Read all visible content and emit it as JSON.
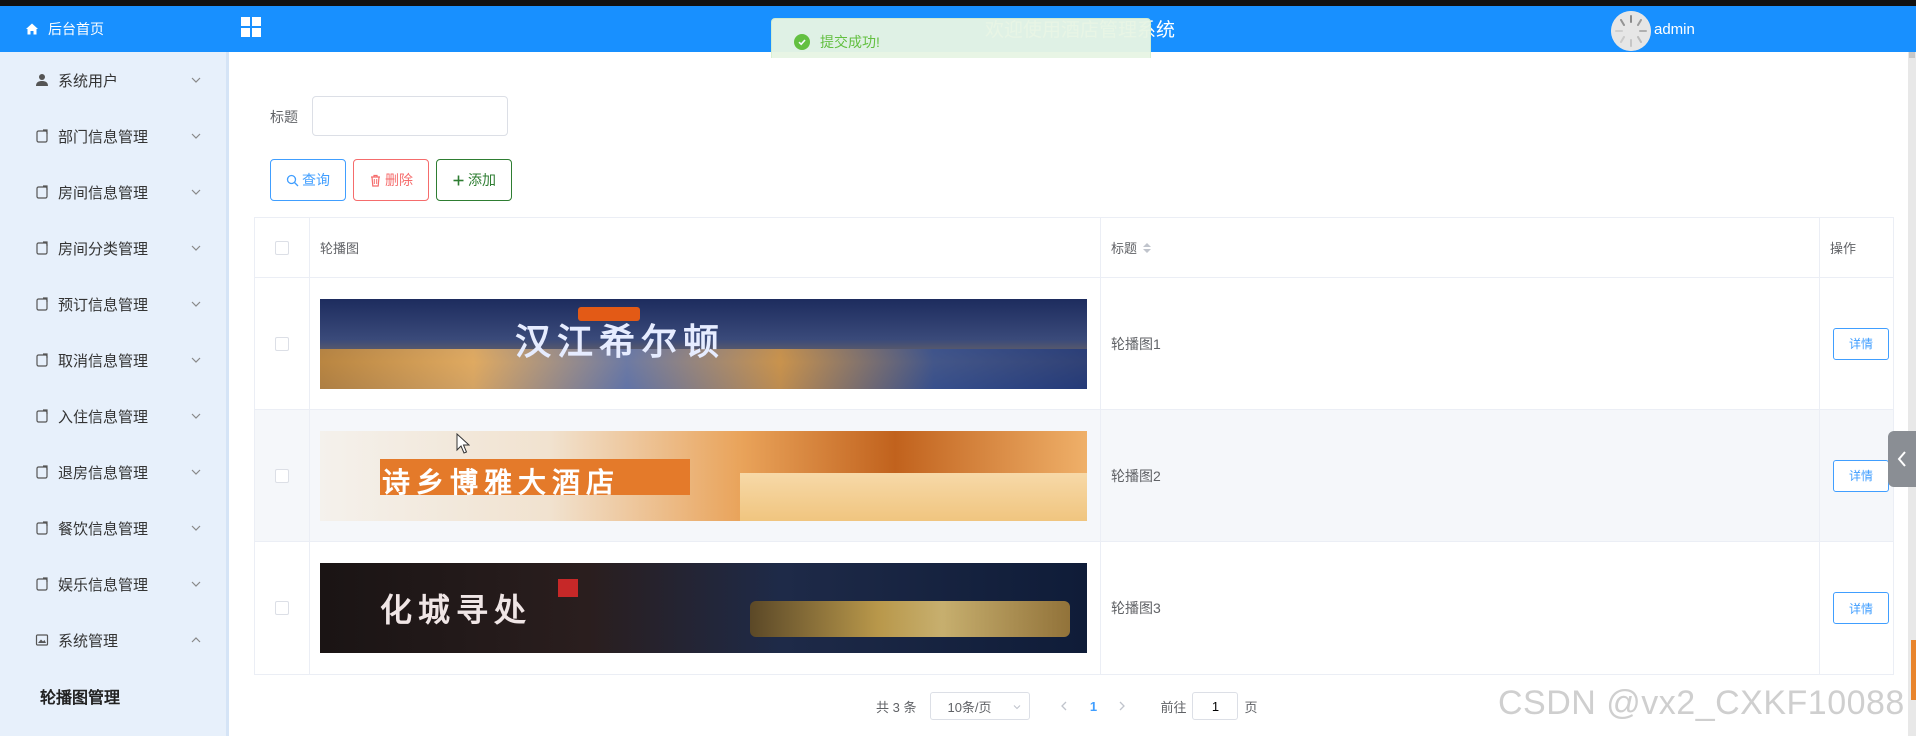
{
  "topbar": {
    "title": "欢迎使用酒店管理系统",
    "username": "admin"
  },
  "toast": {
    "message": "提交成功!"
  },
  "sidebar": {
    "home_label": "后台首页",
    "items": [
      {
        "label": "系统用户",
        "icon": "user-icon"
      },
      {
        "label": "部门信息管理",
        "icon": "document-icon"
      },
      {
        "label": "房间信息管理",
        "icon": "document-icon"
      },
      {
        "label": "房间分类管理",
        "icon": "document-icon"
      },
      {
        "label": "预订信息管理",
        "icon": "document-icon"
      },
      {
        "label": "取消信息管理",
        "icon": "document-icon"
      },
      {
        "label": "入住信息管理",
        "icon": "document-icon"
      },
      {
        "label": "退房信息管理",
        "icon": "document-icon"
      },
      {
        "label": "餐饮信息管理",
        "icon": "document-icon"
      },
      {
        "label": "娱乐信息管理",
        "icon": "document-icon"
      },
      {
        "label": "系统管理",
        "icon": "picture-icon",
        "expanded": true
      }
    ],
    "submenu": {
      "active_label": "轮播图管理"
    }
  },
  "search": {
    "label": "标题",
    "value": ""
  },
  "toolbar": {
    "query_label": "查询",
    "delete_label": "删除",
    "add_label": "添加"
  },
  "table": {
    "columns": {
      "image": "轮播图",
      "title": "标题",
      "actions": "操作"
    },
    "rows": [
      {
        "title": "轮播图1",
        "banner_text": "汉江希尔顿",
        "action": "详情"
      },
      {
        "title": "轮播图2",
        "banner_text": "诗乡博雅大酒店",
        "action": "详情"
      },
      {
        "title": "轮播图3",
        "banner_text": "化城寻处",
        "action": "详情"
      }
    ]
  },
  "pagination": {
    "total": "共 3 条",
    "page_size": "10条/页",
    "current_page": "1",
    "goto_prefix": "前往",
    "goto_value": "1",
    "goto_suffix": "页"
  },
  "watermark": "CSDN @vx2_CXKF10088",
  "colors": {
    "primary": "#1890ff",
    "sidebar_bg": "#e7f0fb",
    "success": "#67c23a",
    "danger": "#f56c6c",
    "add": "#2e7d32"
  }
}
